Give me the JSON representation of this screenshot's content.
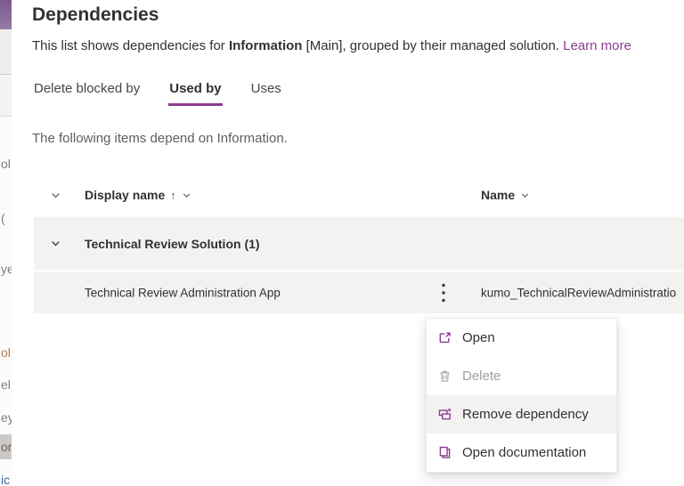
{
  "accent_color": "#8b3c8f",
  "brand_block_color": "#8a689c",
  "panel": {
    "title": "Dependencies",
    "subtitle": {
      "prefix": "This list shows dependencies for ",
      "entity": "Information",
      "suffix": " [Main], grouped by their managed solution. ",
      "link": "Learn more"
    },
    "tabs": [
      {
        "label": "Delete blocked by"
      },
      {
        "label": "Used by"
      },
      {
        "label": "Uses"
      }
    ],
    "active_tab": "Used by",
    "description": "The following items depend on Information.",
    "table": {
      "columns": [
        {
          "label": "Display name",
          "sort": "ascending"
        },
        {
          "label": "Name"
        }
      ],
      "group_row": {
        "label": "Technical Review Solution (1)"
      },
      "rows": [
        {
          "display_name": "Technical Review Administration App",
          "name": "kumo_TechnicalReviewAdministratio"
        }
      ]
    },
    "context_menu": {
      "items": [
        {
          "label": "Open",
          "icon": "open-icon",
          "state": "normal"
        },
        {
          "label": "Delete",
          "icon": "delete-icon",
          "state": "disabled"
        },
        {
          "label": "Remove dependency",
          "icon": "remove-dependency-icon",
          "state": "hovered"
        },
        {
          "label": "Open documentation",
          "icon": "open-documentation-icon",
          "state": "normal"
        }
      ]
    }
  },
  "background_sliver": {
    "fragments": [
      {
        "text": "ol"
      },
      {
        "text": "("
      },
      {
        "text": "ye"
      },
      {
        "text": "ol"
      },
      {
        "text": "el"
      },
      {
        "text": "ey"
      },
      {
        "text": "or"
      },
      {
        "text": "ic"
      }
    ]
  }
}
